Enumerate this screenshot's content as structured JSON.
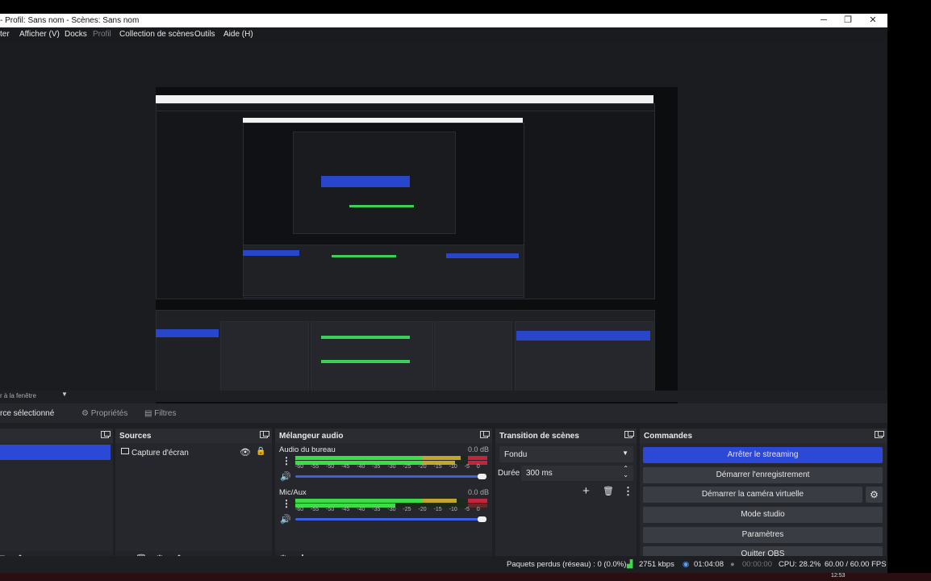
{
  "window": {
    "title": "- Profil: Sans nom - Scènes: Sans nom",
    "controls": {
      "minimize": "─",
      "restore": "❐",
      "close": "✕"
    }
  },
  "menu": {
    "items": [
      "ter",
      "Afficher (V)",
      "Docks",
      "Profil",
      "Collection de scènes",
      "Outils",
      "Aide (H)"
    ]
  },
  "scene_strip": {
    "label": "r à la fenêtre"
  },
  "context_bar": {
    "source_label": "rce sélectionné",
    "properties": "Propriétés",
    "filters": "Filtres"
  },
  "docks": {
    "sources": {
      "title": "Sources",
      "items": [
        {
          "name": "Capture d'écran"
        }
      ]
    },
    "mixer": {
      "title": "Mélangeur audio",
      "channels": [
        {
          "name": "Audio du bureau",
          "db": "0.0 dB",
          "level_left": 0.86,
          "level_right": 0.83
        },
        {
          "name": "Mic/Aux",
          "db": "0.0 dB",
          "level_left": 0.84,
          "level_right": 0.52
        }
      ],
      "ticks": "-60 -55 -50 -45 -40 -35 -30 -25 -20 -15 -10 -5 0"
    },
    "transitions": {
      "title": "Transition de scènes",
      "selected": "Fondu",
      "duration_label": "Durée",
      "duration_value": "300 ms"
    },
    "controls": {
      "title": "Commandes",
      "buttons": {
        "stop_streaming": "Arrêter le streaming",
        "start_recording": "Démarrer l'enregistrement",
        "start_virtual_cam": "Démarrer la caméra virtuelle",
        "studio_mode": "Mode studio",
        "settings": "Paramètres",
        "exit": "Quitter OBS"
      }
    }
  },
  "status": {
    "dropped": "Paquets perdus (réseau) : 0 (0.0%)",
    "bitrate": "2751 kbps",
    "stream_time": "01:04:08",
    "rec_time": "00:00:00",
    "cpu": "CPU: 28.2%",
    "fps": "60.00 / 60.00 FPS"
  },
  "taskbar": {
    "clock": "12:53"
  },
  "colors": {
    "accent_blue": "#2c48d6",
    "meter_green": "#3cdc47",
    "meter_yellow": "#c2a52c",
    "meter_red": "#c3263c"
  }
}
